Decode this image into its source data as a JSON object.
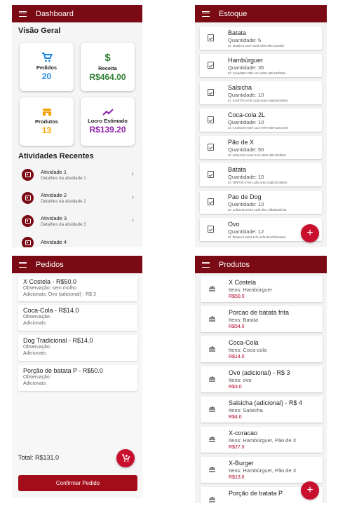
{
  "dashboard": {
    "title": "Dashboard",
    "overview_heading": "Visão Geral",
    "cards": [
      {
        "label": "Pedidos",
        "value": "20",
        "icon": "cart-icon",
        "color": "#1e88e5"
      },
      {
        "label": "Receita",
        "value": "R$464.00",
        "icon": "dollar-icon",
        "color": "#2e7d32"
      },
      {
        "label": "Produtos",
        "value": "13",
        "icon": "store-icon",
        "color": "#f5a000"
      },
      {
        "label": "Lucro Estimado",
        "value": "R$139.20",
        "icon": "trending-up-icon",
        "color": "#8e24aa"
      }
    ],
    "activities_heading": "Atividades Recentes",
    "activities": [
      {
        "title": "Atividade 1",
        "detail": "Detalhes da atividade 1"
      },
      {
        "title": "Atividade 2",
        "detail": "Detalhes da atividade 2"
      },
      {
        "title": "Atividade 3",
        "detail": "Detalhes da atividade 3"
      },
      {
        "title": "Atividade 4",
        "detail": ""
      }
    ]
  },
  "estoque": {
    "title": "Estoque",
    "items": [
      {
        "name": "Batata",
        "qty": "Quantidade: 5",
        "id": "ID: 3bd0bc0-2337-100b-bf06-9f6ccd196fd"
      },
      {
        "name": "Hambúrguer",
        "qty": "Quantidade: 35",
        "id": "ID: 7ae5d830-79fb-11cf-a006-d6fc63cff665"
      },
      {
        "name": "Salsicha",
        "qty": "Quantidade: 10",
        "id": "ID: d1007f70-e74f-11d6-acb0-2da0c8246604"
      },
      {
        "name": "Coca-cola 2L",
        "qty": "Quantidade: 10",
        "id": "ID: e4406e20-86ef-11c3-97f8-8597222e347b"
      },
      {
        "name": "Pão de X",
        "qty": "Quantidade: 50",
        "id": "ID: dd0a4410-6ea2-11cf-a006-d6fc63cff665"
      },
      {
        "name": "Batata",
        "qty": "Quantidade: 10",
        "id": "ID: f4ff9700-e794-11d6-acb0-2da0c8246604"
      },
      {
        "name": "Pao de Dog",
        "qty": "Quantidade: 10",
        "id": "ID: 1efb2ed0-9782-11d5-9f0c-3fd55659fc0d"
      },
      {
        "name": "Ovo",
        "qty": "Quantidade: 12",
        "id": "ID: ff6a8ec0-0ebd-11f1-a2f3-8be0fd2d4a6d"
      }
    ],
    "fab": "+"
  },
  "pedidos": {
    "title": "Pedidos",
    "orders": [
      {
        "title": "X Costela - R$50.0",
        "obs": "Observação: sem molho",
        "add": "Adicionais: Ovo (adicional) - R$ 3"
      },
      {
        "title": "Coca-Cola - R$14.0",
        "obs": "Observação:",
        "add": "Adicionais:"
      },
      {
        "title": "Dog Tradicional - R$14.0",
        "obs": "Observação:",
        "add": "Adicionais:"
      },
      {
        "title": "Porção de batata P - R$50.0",
        "obs": "Observação:",
        "add": "Adicionais:"
      }
    ],
    "total": "Total: R$131.0",
    "confirm": "Confirmar Pedido"
  },
  "produtos": {
    "title": "Produtos",
    "items": [
      {
        "name": "X Costela",
        "items": "Itens: Hambúrguer",
        "price": "R$50.0"
      },
      {
        "name": "Porcao de batata frita",
        "items": "Itens: Batata",
        "price": "R$54.0"
      },
      {
        "name": "Coca-Cola",
        "items": "Itens: Coca-cola",
        "price": "R$14.0"
      },
      {
        "name": "Ovo (adicional) - R$ 3",
        "items": "Itens: ovo",
        "price": "R$3.0"
      },
      {
        "name": "Salsicha (adicional) - R$ 4",
        "items": "Itens: Salsicha",
        "price": "R$4.0"
      },
      {
        "name": "X-coracao",
        "items": "Itens: Hambúrguer, Pão de X",
        "price": "R$27.0"
      },
      {
        "name": "X-Burger",
        "items": "Itens: Hambúrguer, Pão de X",
        "price": "R$13.0"
      },
      {
        "name": "Porção de batata P",
        "items": "",
        "price": ""
      }
    ],
    "fab": "+"
  },
  "colors": {
    "appbar": "#7a0a14",
    "fab": "#c8102e",
    "price": "#b00020"
  }
}
